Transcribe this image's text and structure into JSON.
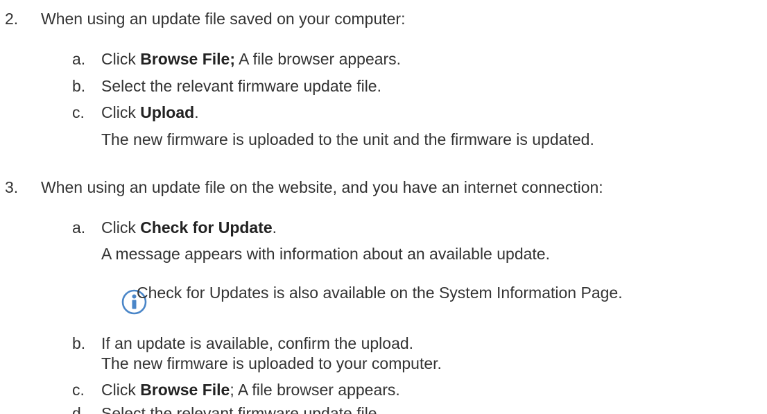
{
  "steps": [
    {
      "num": "2.",
      "text": "When using an update file saved on your computer:",
      "substeps": [
        {
          "letter": "a.",
          "pre": "Click ",
          "bold": "Browse File;",
          "post": " A file browser appears."
        },
        {
          "letter": "b.",
          "text": "Select the relevant firmware update file."
        },
        {
          "letter": "c.",
          "pre": "Click ",
          "bold": "Upload",
          "post": ".",
          "result": "The new firmware is uploaded to the unit and the firmware is updated."
        }
      ]
    },
    {
      "num": "3.",
      "text": "When using an update file on the website, and you have an internet connection:",
      "substeps": [
        {
          "letter": "a.",
          "pre": "Click ",
          "bold": "Check for Update",
          "post": ".",
          "result": "A message appears with information about an available update."
        },
        {
          "letter": "b.",
          "text": "If an update is available, confirm the upload.",
          "result": "The new firmware is uploaded to your computer."
        },
        {
          "letter": "c.",
          "pre": "Click ",
          "bold": "Browse File",
          "post": "; A file browser appears."
        },
        {
          "letter": "d.",
          "text": "Select the relevant firmware update file."
        }
      ]
    }
  ],
  "note": {
    "icon": "info-icon",
    "icon_color": "#4a86c8",
    "text": "Check for Updates is also available on the System Information Page."
  }
}
